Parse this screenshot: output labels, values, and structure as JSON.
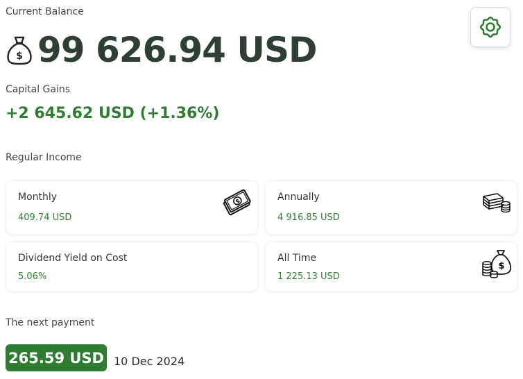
{
  "balance": {
    "label": "Current Balance",
    "value": "99 626.94 USD",
    "icon": "moneybag-icon"
  },
  "capital_gains": {
    "label": "Capital Gains",
    "value": "+2 645.62 USD (+1.36%)"
  },
  "settings": {
    "icon": "gear-icon",
    "accent_color": "#2e7d32"
  },
  "regular_income": {
    "label": "Regular Income",
    "cards": [
      {
        "title": "Monthly",
        "value": "409.74 USD",
        "icon": "cash-icon"
      },
      {
        "title": "Annually",
        "value": "4 916.85 USD",
        "icon": "money-stack-icon"
      },
      {
        "title": "Dividend Yield on Cost",
        "value": "5.06%",
        "icon": ""
      },
      {
        "title": "All Time",
        "value": "1 225.13 USD",
        "icon": "money-bag-coins-icon"
      }
    ]
  },
  "next_payment": {
    "label": "The next payment",
    "amount": "265.59 USD",
    "date": "10 Dec 2024"
  },
  "colors": {
    "positive": "#2e7d32",
    "balance_text": "#2f3f33"
  }
}
